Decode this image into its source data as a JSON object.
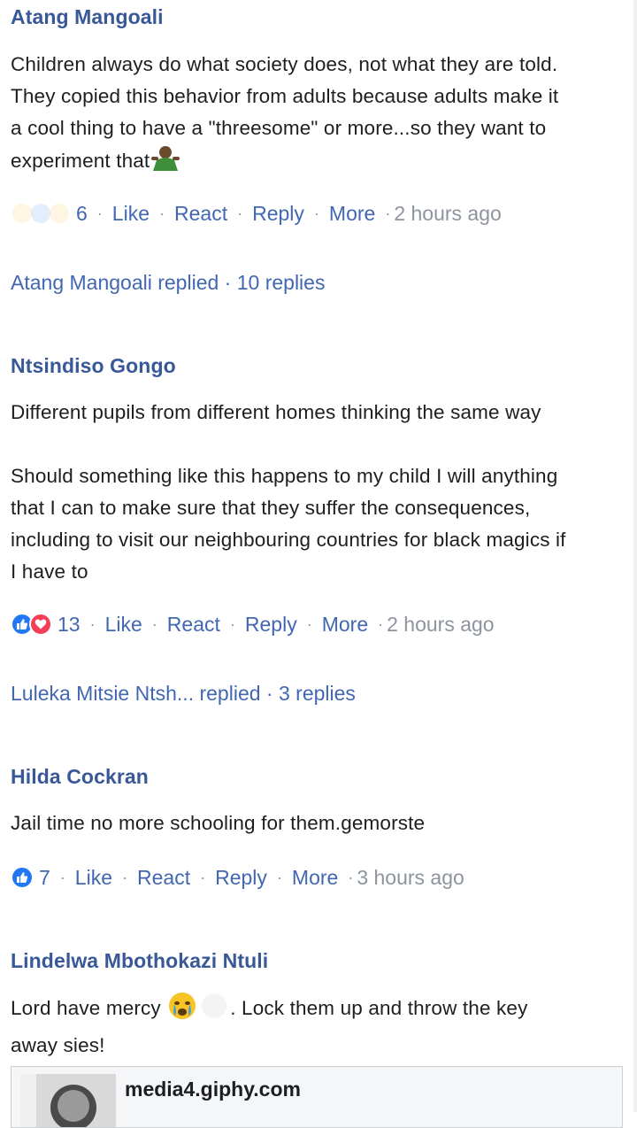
{
  "comments": [
    {
      "author": "Atang Mangoali",
      "text_lines": [
        "Children always do what society does, not what they are told.",
        "They copied this behavior from adults because adults make it",
        "a cool thing to have a \"threesome\" or more...so they want to",
        "experiment that"
      ],
      "reactions": {
        "icons": [
          "haha-icon",
          "like-icon",
          "wow-icon"
        ],
        "count": "6"
      },
      "actions": {
        "like": "Like",
        "react": "React",
        "reply": "Reply",
        "more": "More",
        "time": "2 hours ago"
      },
      "replies_summary": {
        "name": "Atang Mangoali",
        "replied": "replied",
        "count": "10 replies"
      }
    },
    {
      "author": "Ntsindiso Gongo",
      "paragraph1": "Different pupils from different homes thinking the same way",
      "paragraph2_lines": [
        "Should something like this happens to my child I will anything",
        "that I can to make sure that they suffer the consequences,",
        "including to visit our neighbouring countries for black magics if",
        "I have to"
      ],
      "reactions": {
        "icons": [
          "like-icon",
          "love-icon"
        ],
        "count": "13"
      },
      "actions": {
        "like": "Like",
        "react": "React",
        "reply": "Reply",
        "more": "More",
        "time": "2 hours ago"
      },
      "replies_summary": {
        "name": "Luleka Mitsie Ntsh...",
        "replied": "replied",
        "count": "3 replies"
      }
    },
    {
      "author": "Hilda Cockran",
      "text": "Jail time no more schooling for them.gemorste",
      "reactions": {
        "icons": [
          "like-icon"
        ],
        "count": "7"
      },
      "actions": {
        "like": "Like",
        "react": "React",
        "reply": "Reply",
        "more": "More",
        "time": "3 hours ago"
      }
    },
    {
      "author": "Lindelwa Mbothokazi Ntuli",
      "text_before_emoji": "Lord have mercy ",
      "text_after_emoji": ". Lock them up and throw the key",
      "text_line2": "away sies!",
      "link_preview": {
        "domain": "media4.giphy.com"
      }
    }
  ],
  "colors": {
    "name_blue": "#385898",
    "action_blue": "#4267b2",
    "muted_grey": "#8d949e",
    "like_blue": "#2078f4",
    "love_red": "#f33e58"
  }
}
